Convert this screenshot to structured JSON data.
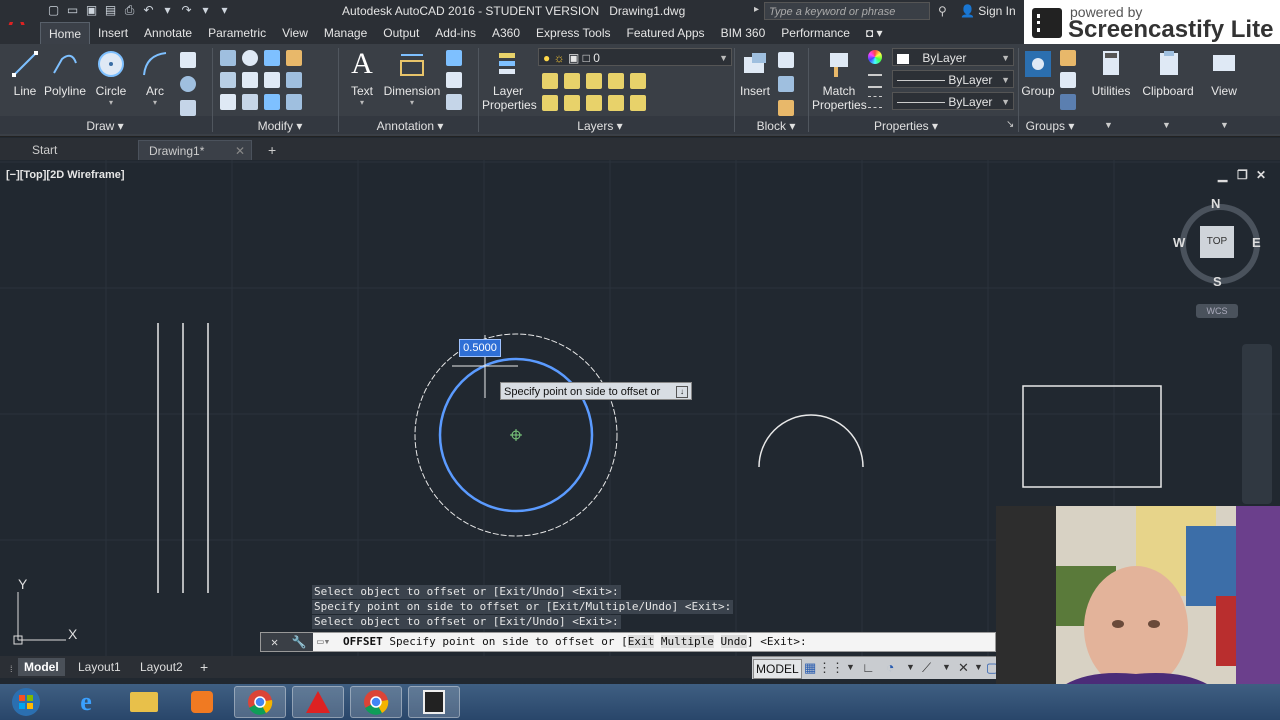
{
  "title_bar": {
    "app_title": "Autodesk AutoCAD 2016 - STUDENT VERSION",
    "file_name": "Drawing1.dwg",
    "search_placeholder": "Type a keyword or phrase",
    "sign_in": "Sign In"
  },
  "overlay": {
    "line1": "powered by",
    "line2": "Screencastify Lite"
  },
  "ribbon_tabs": [
    "Home",
    "Insert",
    "Annotate",
    "Parametric",
    "View",
    "Manage",
    "Output",
    "Add-ins",
    "A360",
    "Express Tools",
    "Featured Apps",
    "BIM 360",
    "Performance"
  ],
  "ribbon": {
    "draw": {
      "line": "Line",
      "polyline": "Polyline",
      "circle": "Circle",
      "arc": "Arc",
      "title": "Draw"
    },
    "modify": {
      "title": "Modify"
    },
    "annotation": {
      "text": "Text",
      "dimension": "Dimension",
      "title": "Annotation"
    },
    "layers": {
      "layer_properties_1": "Layer",
      "layer_properties_2": "Properties",
      "current_layer": "0",
      "title": "Layers"
    },
    "block": {
      "insert": "Insert",
      "title": "Block"
    },
    "properties": {
      "match_1": "Match",
      "match_2": "Properties",
      "color": "ByLayer",
      "linetype": "ByLayer",
      "lineweight": "ByLayer",
      "title": "Properties"
    },
    "groups": {
      "group": "Group",
      "title": "Groups"
    },
    "utilities": "Utilities",
    "clipboard": "Clipboard",
    "view": "View"
  },
  "file_tabs": {
    "start": "Start",
    "drawing": "Drawing1*"
  },
  "viewport": {
    "label": "[−][Top][2D Wireframe]",
    "dynamic_input_value": "0.5000",
    "tooltip": "Specify point on side to offset or",
    "viewcube": {
      "n": "N",
      "s": "S",
      "e": "E",
      "w": "W",
      "face": "TOP",
      "wcs": "WCS"
    },
    "ucs": {
      "x": "X",
      "y": "Y"
    }
  },
  "command_history": [
    "Select object to offset or [Exit/Undo] <Exit>:",
    "Specify point on side to offset or [Exit/Multiple/Undo] <Exit>:",
    "Select object to offset or [Exit/Undo] <Exit>:"
  ],
  "command_line": {
    "command": "OFFSET",
    "prompt": "Specify point on side to offset or [",
    "opt1": "Exit",
    "opt2": "Multiple",
    "opt3": "Undo",
    "tail": "] <Exit>:"
  },
  "layout_tabs": [
    "Model",
    "Layout1",
    "Layout2"
  ],
  "status": {
    "model": "MODEL"
  },
  "colors": {
    "accent": "#4a90e2",
    "selection": "#5b9bff",
    "background": "#212830"
  }
}
